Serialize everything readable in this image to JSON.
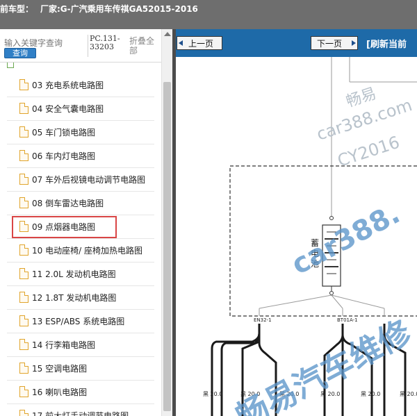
{
  "titlebar": {
    "label": "前车型：",
    "vendor": "厂家:G-广汽乘用车传祺GA52015-2016"
  },
  "sidebar": {
    "search_placeholder": "输入关键字查询",
    "search_button": "查询",
    "pc_code": "PC.131-33203",
    "collapse_all": "折叠全部",
    "items": [
      {
        "label": "03 充电系统电路图"
      },
      {
        "label": "04 安全气囊电路图"
      },
      {
        "label": "05 车门锁电路图"
      },
      {
        "label": "06 车内灯电路图"
      },
      {
        "label": "07 车外后视镜电动调节电路图"
      },
      {
        "label": "08 倒车雷达电路图"
      },
      {
        "label": "09 点烟器电路图",
        "selected": true
      },
      {
        "label": "10 电动座椅/ 座椅加热电路图"
      },
      {
        "label": "11 2.0L 发动机电路图"
      },
      {
        "label": "12 1.8T 发动机电路图"
      },
      {
        "label": "13 ESP/ABS 系统电路图"
      },
      {
        "label": "14 行李箱电路图"
      },
      {
        "label": "15 空调电路图"
      },
      {
        "label": "16 喇叭电路图"
      },
      {
        "label": "17 前大灯手动调节电路图"
      }
    ]
  },
  "toolbar": {
    "prev_label": "上一页",
    "next_label": "下一页",
    "refresh_label": "[刷新当前"
  },
  "diagram": {
    "component_label": "蓄电池",
    "connector_left": "EN32-1",
    "connector_right": "BT01A-1",
    "wire_color_label": "黑",
    "wire_size_label": "20.0",
    "watermarks": {
      "line1": "畅易",
      "line2": "car388.com",
      "line3": "CY2016",
      "line4": "car388.",
      "line5": "畅易汽车维修"
    }
  },
  "colors": {
    "titlebar": "#6e6e6e",
    "toolbar": "#1e6aa8",
    "search_button": "#2f7fc6",
    "selection_border": "#d94545",
    "doc_icon": "#e0a42b",
    "watermark": "#5b95c9"
  }
}
